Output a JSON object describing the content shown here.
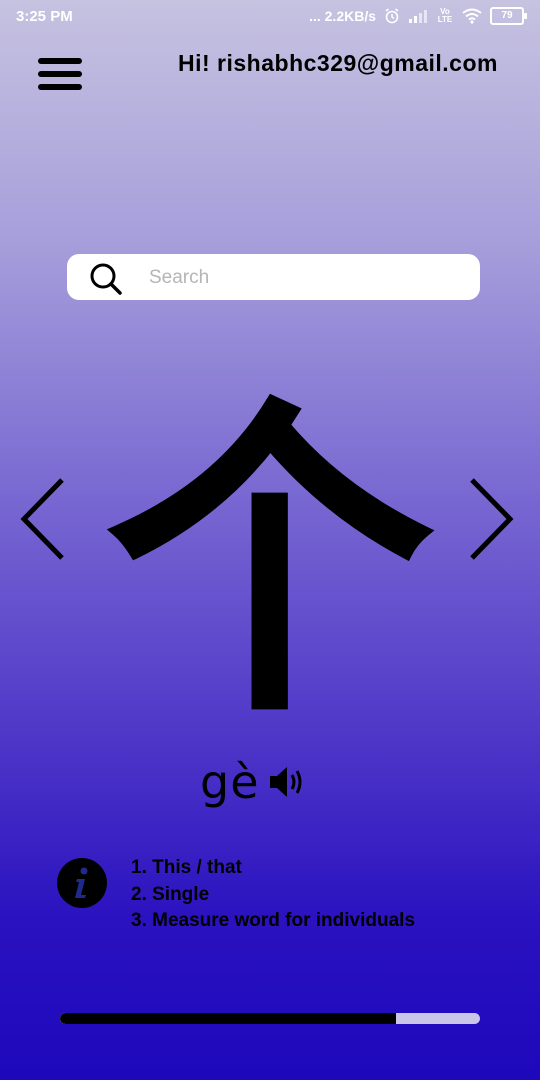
{
  "status_bar": {
    "time": "3:25 PM",
    "speed": "... 2.2KB/s",
    "network": "Vo LTE",
    "battery": "79",
    "icons": [
      "alarm-icon",
      "signal-icon",
      "wifi-icon",
      "battery-icon"
    ]
  },
  "header": {
    "menu_icon": "hamburger-menu-icon",
    "greeting": "Hi! rishabhc329@gmail.com"
  },
  "search": {
    "placeholder": "Search",
    "value": "",
    "icon": "search-icon"
  },
  "flashcard": {
    "character": "个",
    "pinyin": "gè",
    "prev_icon": "chevron-left-icon",
    "next_icon": "chevron-right-icon",
    "audio_icon": "speaker-icon",
    "info_icon": "info-icon",
    "meanings": [
      "1. This / that",
      "2. Single",
      "3. Measure word for individuals"
    ]
  },
  "progress": {
    "fraction": 0.8
  },
  "colors": {
    "gradient_top": "#c6c2e0",
    "gradient_bottom": "#1e08bb",
    "progress_fill": "#000000",
    "progress_track": "#c9c6ea"
  }
}
